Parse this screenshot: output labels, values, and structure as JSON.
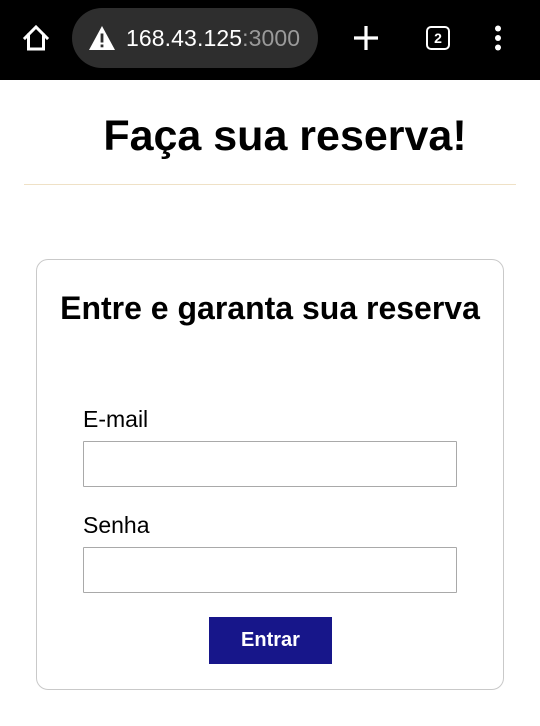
{
  "browser": {
    "url_host": "168.43.125",
    "url_port": ":3000",
    "tab_count": "2",
    "icons": {
      "home": "home-icon",
      "warning": "warning-icon",
      "new_tab": "plus-icon",
      "tabs": "tabs-icon",
      "menu": "more-vert-icon"
    }
  },
  "page": {
    "title": "Faça sua reserva!"
  },
  "login_card": {
    "heading": "Entre e garanta sua reserva",
    "email_label": "E-mail",
    "email_value": "",
    "password_label": "Senha",
    "password_value": "",
    "submit_label": "Entrar"
  },
  "colors": {
    "browser_bar": "#000000",
    "url_pill": "#2e2e2e",
    "url_port": "#9a9a9a",
    "divider": "#efe1c6",
    "card_border": "#c9c9c9",
    "button": "#17168a",
    "button_text": "#ffffff"
  }
}
